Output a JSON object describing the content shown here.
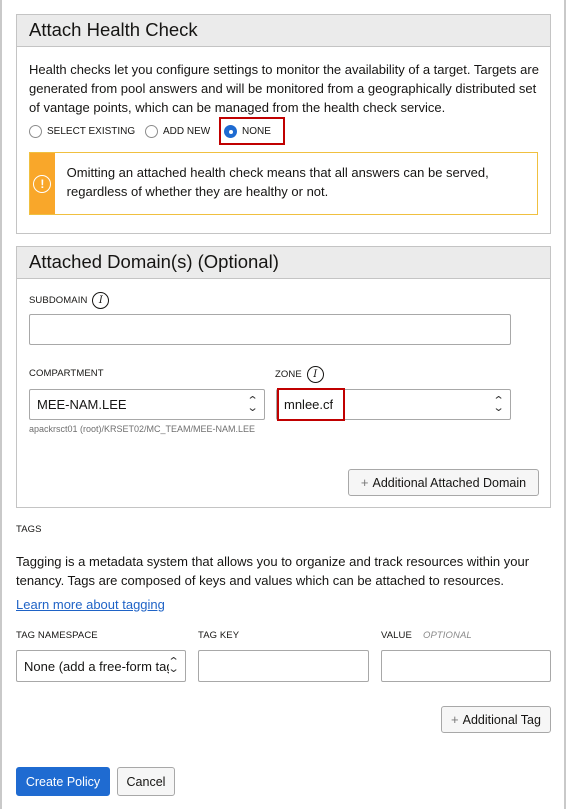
{
  "health_check": {
    "title": "Attach Health Check",
    "description": "Health checks let you configure settings to monitor the availability of a target. Targets are generated from pool answers and will be monitored from a geographically distributed set of vantage points, which can be managed from the health check service.",
    "options": [
      {
        "label": "SELECT EXISTING",
        "selected": false
      },
      {
        "label": "ADD NEW",
        "selected": false
      },
      {
        "label": "NONE",
        "selected": true
      }
    ],
    "alert_text": "Omitting an attached health check means that all answers can be served, regardless of whether they are healthy or not."
  },
  "domains": {
    "title": "Attached Domain(s) (Optional)",
    "subdomain_label": "SUBDOMAIN",
    "subdomain_value": "",
    "compartment_label": "COMPARTMENT",
    "compartment_value": "MEE-NAM.LEE",
    "compartment_path": "apackrsct01 (root)/KRSET02/MC_TEAM/MEE-NAM.LEE",
    "zone_label": "ZONE",
    "zone_value": "mnlee.cf",
    "add_domain_button": "Additional Attached Domain"
  },
  "tags": {
    "heading": "TAGS",
    "description": "Tagging is a metadata system that allows you to organize and track resources within your tenancy. Tags are composed of keys and values which can be attached to resources.",
    "learn_more": "Learn more about tagging",
    "namespace_label": "TAG NAMESPACE",
    "namespace_value": "None (add a free-form tag)",
    "key_label": "TAG KEY",
    "key_value": "",
    "value_label": "VALUE",
    "value_optional": "OPTIONAL",
    "value_value": "",
    "add_tag_button": "Additional Tag"
  },
  "footer": {
    "create_button": "Create Policy",
    "cancel_button": "Cancel"
  },
  "colors": {
    "primary": "#1f6bd1",
    "warning": "#f9a72a",
    "highlight": "#c00000",
    "link": "#1f63c6"
  }
}
